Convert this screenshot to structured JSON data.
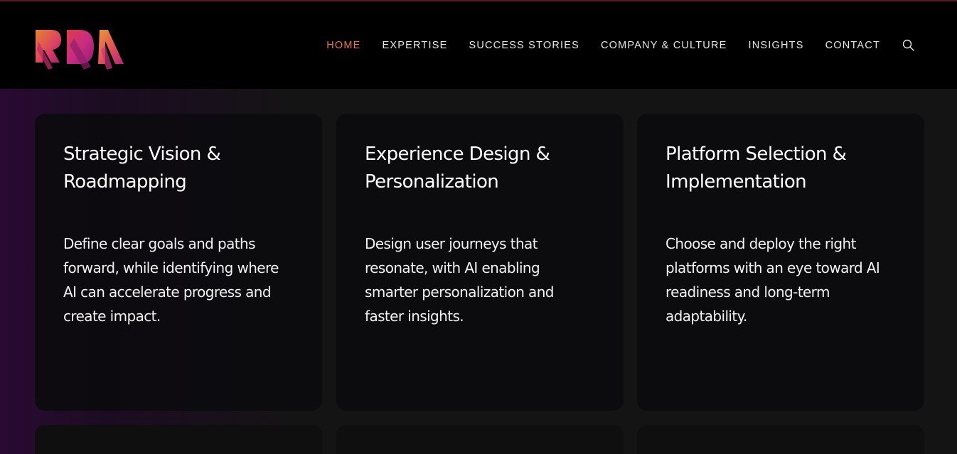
{
  "nav": {
    "items": [
      {
        "label": "HOME",
        "active": true
      },
      {
        "label": "EXPERTISE",
        "active": false
      },
      {
        "label": "SUCCESS STORIES",
        "active": false
      },
      {
        "label": "COMPANY & CULTURE",
        "active": false
      },
      {
        "label": "INSIGHTS",
        "active": false
      },
      {
        "label": "CONTACT",
        "active": false
      }
    ],
    "search_icon": "search-icon",
    "active_color": "#e8763a"
  },
  "logo": {
    "text": "RDA"
  },
  "cards": [
    {
      "title": "Strategic Vision & Roadmapping",
      "body": "Define clear goals and paths forward, while identifying where AI can accelerate progress and create impact."
    },
    {
      "title": "Experience Design & Personalization",
      "body": "Design user journeys that resonate, with AI enabling smarter personalization and faster insights."
    },
    {
      "title": "Platform Selection & Implementation",
      "body": "Choose and deploy the right platforms with an eye toward AI readiness and long-term adaptability."
    }
  ],
  "colors": {
    "header_bg": "#000000",
    "page_bg": "#141414",
    "card_bg": "#0c0b0e"
  }
}
